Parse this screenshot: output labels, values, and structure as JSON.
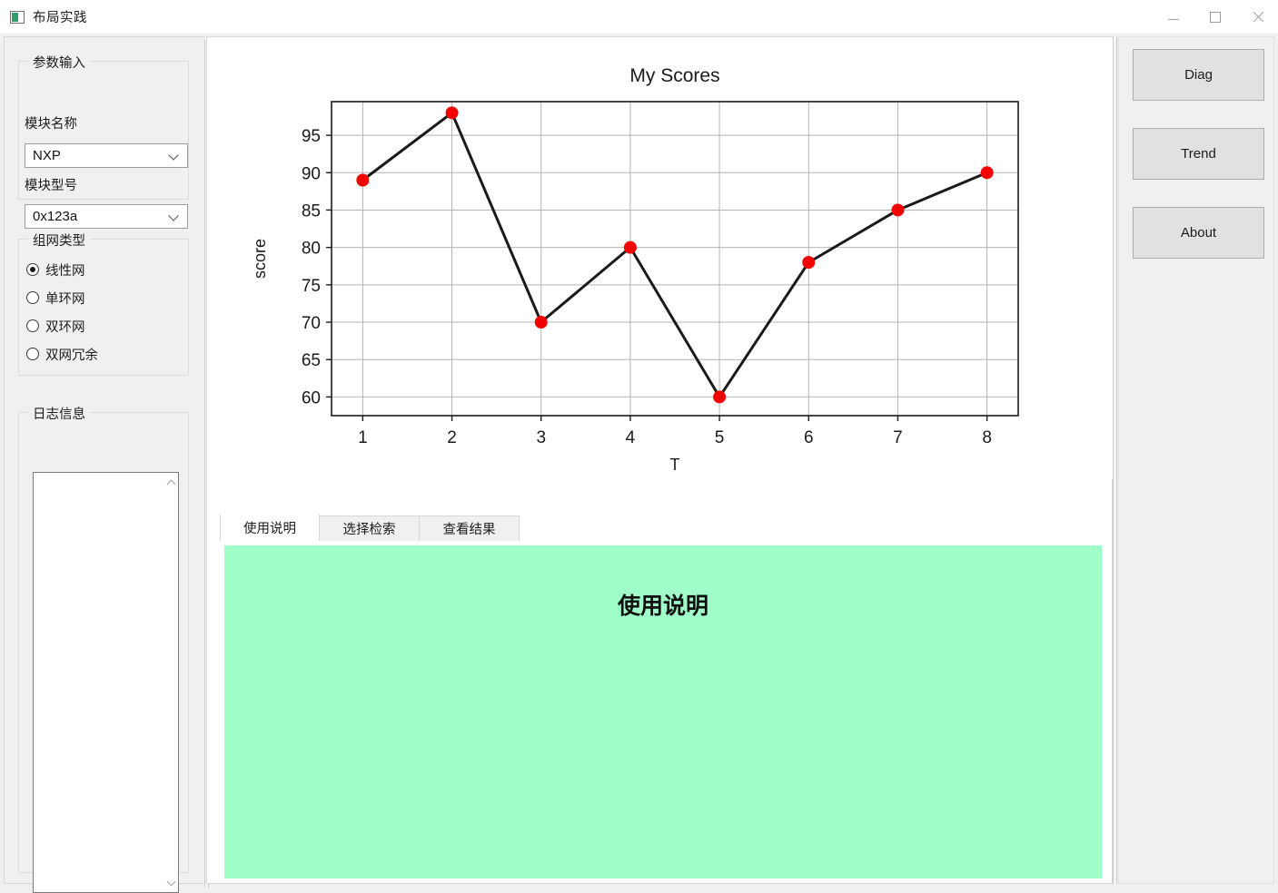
{
  "window": {
    "title": "布局实践",
    "icon": "app-icon",
    "controls": {
      "minimize": "minimize-icon",
      "maximize": "maximize-icon",
      "close": "close-icon"
    }
  },
  "left_panel": {
    "param_group": {
      "title": "参数输入",
      "module_name_label": "模块名称",
      "module_name_value": "NXP",
      "module_type_label": "模块型号",
      "module_type_value": "0x123a"
    },
    "network_group": {
      "title": "组网类型",
      "options": [
        {
          "label": "线性网",
          "checked": true
        },
        {
          "label": "单环网",
          "checked": false
        },
        {
          "label": "双环网",
          "checked": false
        },
        {
          "label": "双网冗余",
          "checked": false
        }
      ]
    },
    "log_group": {
      "title": "日志信息",
      "text": ""
    }
  },
  "tabs": {
    "items": [
      {
        "label": "使用说明",
        "active": true
      },
      {
        "label": "选择检索",
        "active": false
      },
      {
        "label": "查看结果",
        "active": false
      }
    ],
    "content_heading": "使用说明",
    "content_background": "#a0ffc8"
  },
  "right_panel": {
    "buttons": [
      {
        "label": "Diag"
      },
      {
        "label": "Trend"
      },
      {
        "label": "About"
      }
    ]
  },
  "chart_data": {
    "type": "line",
    "title": "My Scores",
    "xlabel": "T",
    "ylabel": "score",
    "x": [
      1,
      2,
      3,
      4,
      5,
      6,
      7,
      8
    ],
    "values": [
      89,
      98,
      70,
      80,
      60,
      78,
      85,
      90
    ],
    "xticks": [
      1,
      2,
      3,
      4,
      5,
      6,
      7,
      8
    ],
    "yticks": [
      60,
      65,
      70,
      75,
      80,
      85,
      90,
      95
    ],
    "xlim": [
      0.65,
      8.35
    ],
    "ylim": [
      57.5,
      99.5
    ],
    "grid": true,
    "legend": null,
    "line_color": "#1a1a1a",
    "marker_color": "#f40000",
    "marker": "circle"
  }
}
